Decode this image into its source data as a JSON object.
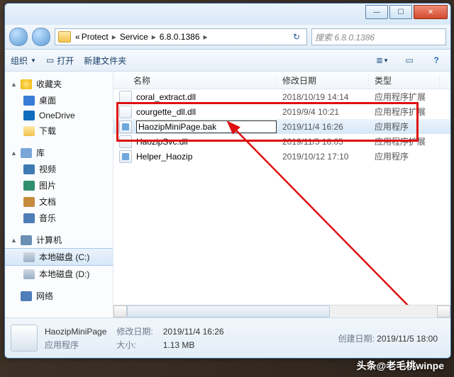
{
  "window": {
    "buttons": {
      "min": "—",
      "max": "☐",
      "close": "✕"
    }
  },
  "nav": {
    "crumb_prefix": "«",
    "crumbs": [
      "Protect",
      "Service",
      "6.8.0.1386"
    ],
    "search_prefix": "搜索",
    "search_folder": "6.8.0.1386",
    "refresh": "↻"
  },
  "toolbar": {
    "organize": "组织",
    "open": "打开",
    "newfolder": "新建文件夹"
  },
  "sidebar": {
    "favorites": {
      "label": "收藏夹",
      "items": [
        {
          "label": "桌面",
          "cls": "desk"
        },
        {
          "label": "OneDrive",
          "cls": "cloud"
        },
        {
          "label": "下载",
          "cls": "dl"
        }
      ]
    },
    "libraries": {
      "label": "库",
      "items": [
        {
          "label": "视频",
          "cls": "vid"
        },
        {
          "label": "图片",
          "cls": "pic"
        },
        {
          "label": "文档",
          "cls": "doc"
        },
        {
          "label": "音乐",
          "cls": "mus"
        }
      ]
    },
    "computer": {
      "label": "计算机",
      "items": [
        {
          "label": "本地磁盘 (C:)",
          "cls": "hdd",
          "selected": true
        },
        {
          "label": "本地磁盘 (D:)",
          "cls": "hdd"
        }
      ]
    },
    "network": {
      "label": "网络"
    }
  },
  "columns": {
    "name": "名称",
    "date": "修改日期",
    "type": "类型"
  },
  "files": [
    {
      "name": "coral_extract.dll",
      "date": "2018/10/19 14:14",
      "type": "应用程序扩展",
      "icon": "dll"
    },
    {
      "name": "courgette_dll.dll",
      "date": "2019/9/4 10:21",
      "type": "应用程序扩展",
      "icon": "dll"
    },
    {
      "name": "HaozipMiniPage.bak",
      "date": "2019/11/4 16:26",
      "type": "应用程序",
      "icon": "app",
      "editing": true,
      "selected": true
    },
    {
      "name": "HaozipSvc.dll",
      "date": "2019/11/5 18:05",
      "type": "应用程序扩展",
      "icon": "dll"
    },
    {
      "name": "Helper_Haozip",
      "date": "2019/10/12 17:10",
      "type": "应用程序",
      "icon": "app"
    }
  ],
  "status": {
    "filename": "HaozipMiniPage",
    "filetype": "应用程序",
    "mod_label": "修改日期:",
    "mod_value": "2019/11/4 16:26",
    "size_label": "大小:",
    "size_value": "1.13 MB",
    "create_label": "创建日期:",
    "create_value": "2019/11/5 18:00"
  },
  "watermark": "头条@老毛桃winpe"
}
